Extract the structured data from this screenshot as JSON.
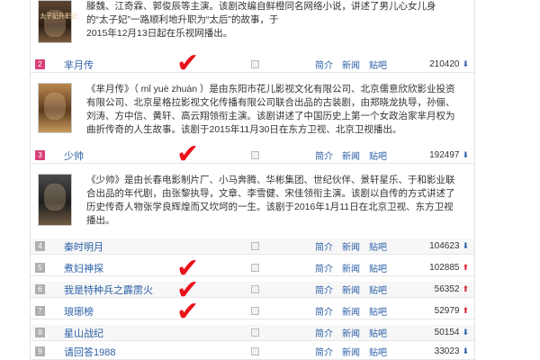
{
  "top_desc": {
    "line1": "滕魏、江奇霖、郭俊辰等主演。该剧改编自鲜橙同名网络小说，讲述了男儿心女儿身的“太子妃”一路顺利地升职为“太后”的故事，于",
    "line2": "2015年12月13日起在乐视网播出。",
    "poster_caption": "太子妃升职记"
  },
  "rows": [
    {
      "rank": "2",
      "title": "芈月传",
      "links": [
        "简介",
        "新闻",
        "贴吧"
      ],
      "count": "210420",
      "trend": "down",
      "desc": "《芈月传》（ mǐ yuè zhuàn ）是由东阳市花儿影视文化有限公司、北京儒意欣欣影业投资有限公司、北京星格拉影视文化传播有限公司联合出品的古装剧，由郑晓龙执导，孙俪、刘涛、方中信、黄轩、高云翔领衔主演。该剧讲述了中国历史上第一个女政治家芈月权为曲折传奇的人生故事。该剧于2015年11月30日在东方卫视、北京卫视播出。"
    },
    {
      "rank": "3",
      "title": "少帅",
      "links": [
        "简介",
        "新闻",
        "贴吧"
      ],
      "count": "192497",
      "trend": "down",
      "desc": "《少帅》是由长春电影制片厂、小马奔腾、华彬集团、世纪伙伴、景轩星乐、于和影业联合出品的年代剧，由张黎执导，文章、李雪健、宋佳领衔主演。该剧以自传的方式讲述了历史传奇人物张学良辉煌而又坎坷的一生。该剧于2016年1月11日在北京卫视、东方卫视播出。"
    },
    {
      "rank": "4",
      "title": "秦时明月",
      "links": [
        "简介",
        "新闻",
        "贴吧"
      ],
      "count": "104623",
      "trend": "down"
    },
    {
      "rank": "5",
      "title": "煮妇神探",
      "links": [
        "简介",
        "新闻",
        "贴吧"
      ],
      "count": "102885",
      "trend": "up"
    },
    {
      "rank": "6",
      "title": "我是特种兵之霹雳火",
      "links": [
        "简介",
        "新闻",
        "贴吧"
      ],
      "count": "56352",
      "trend": "up"
    },
    {
      "rank": "7",
      "title": "琅琊榜",
      "links": [
        "简介",
        "新闻",
        "贴吧"
      ],
      "count": "52979",
      "trend": "up"
    },
    {
      "rank": "8",
      "title": "星山战纪",
      "links": [
        "简介",
        "新闻",
        "贴吧"
      ],
      "count": "50154",
      "trend": "down"
    },
    {
      "rank": "9",
      "title": "请回答1988",
      "links": [
        "简介",
        "新闻",
        "贴吧"
      ],
      "count": "33023",
      "trend": "down"
    }
  ],
  "colors": {
    "link": "#2b5fa6",
    "check": "#e8131b",
    "up": "#dd2222",
    "rank_top": "#d9407a"
  },
  "icons": {
    "annotation": "check-mark-icon",
    "trend_down": "arrow-down-icon",
    "trend_up": "arrow-up-icon",
    "mini": "square-icon"
  }
}
